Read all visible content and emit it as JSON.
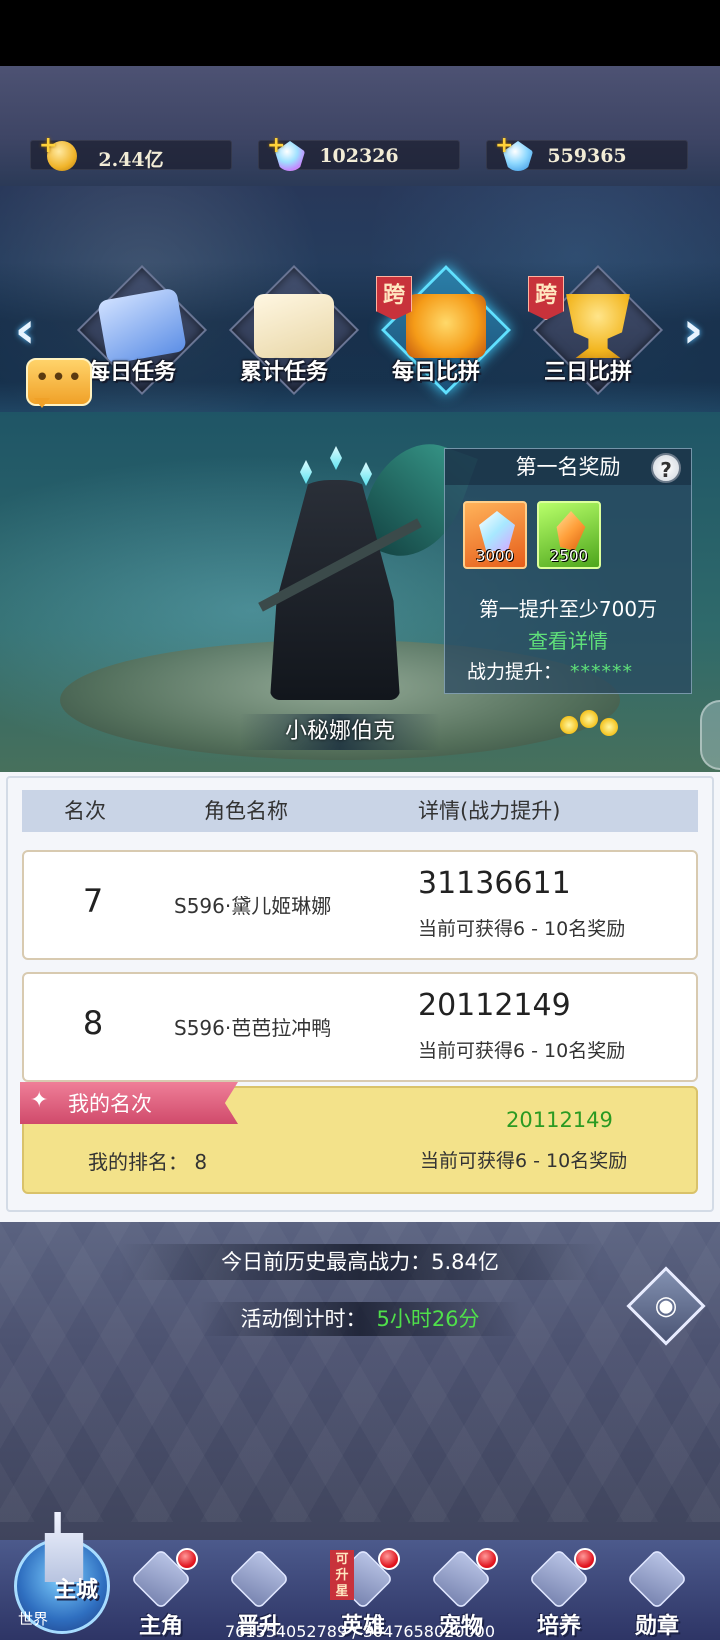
{
  "resources": [
    {
      "icon": "gold-coin-icon",
      "value": "2.44亿"
    },
    {
      "icon": "rainbow-gem-icon",
      "value": "102326"
    },
    {
      "icon": "blue-diamond-icon",
      "value": "559365"
    }
  ],
  "tabs": [
    {
      "label": "每日任务",
      "icon": "task-scroll-icon",
      "cross": ""
    },
    {
      "label": "累计任务",
      "icon": "checklist-icon",
      "cross": ""
    },
    {
      "label": "每日比拼",
      "icon": "medal-icon",
      "cross": "跨",
      "active": true
    },
    {
      "label": "三日比拼",
      "icon": "trophy-icon",
      "cross": "跨"
    }
  ],
  "chat": {
    "dots": "•••"
  },
  "hero": {
    "name": "小秘娜伯克"
  },
  "reward_panel": {
    "title": "第一名奖励",
    "help": "?",
    "items": [
      {
        "icon": "diamond-item-icon",
        "count": "3000"
      },
      {
        "icon": "crystal-shard-icon",
        "count": "2500"
      }
    ],
    "requirement": "第一提升至少700万",
    "detail_link": "查看详情",
    "boost_label": "战力提升：",
    "boost_value": "******"
  },
  "table": {
    "headers": [
      "名次",
      "角色名称",
      "详情(战力提升)"
    ],
    "rows": [
      {
        "rank": "7",
        "name": "S596·黛儿姬琳娜",
        "power": "31136611",
        "reward": "当前可获得6 - 10名奖励"
      },
      {
        "rank": "8",
        "name": "S596·芭芭拉冲鸭",
        "power": "20112149",
        "reward": "当前可获得6 - 10名奖励"
      }
    ]
  },
  "my_rank": {
    "ribbon": "我的名次",
    "star": "✦",
    "rank_text": "我的排名：  8",
    "power": "20112149",
    "reward": "当前可获得6 - 10名奖励"
  },
  "history": "今日前历史最高战力：5.84亿",
  "countdown": {
    "label": "活动倒计时：",
    "value": "5小时26分"
  },
  "nav": {
    "main_city": "主城",
    "world": "世界",
    "items": [
      {
        "label": "主角",
        "dot": true
      },
      {
        "label": "晋升",
        "dot": false
      },
      {
        "label": "英雄",
        "dot": true,
        "tag": "可升星"
      },
      {
        "label": "宠物",
        "dot": true
      },
      {
        "label": "培养",
        "dot": true
      },
      {
        "label": "勋章",
        "dot": false
      }
    ]
  },
  "footer_ids": "761554052789 / 3047658020000"
}
